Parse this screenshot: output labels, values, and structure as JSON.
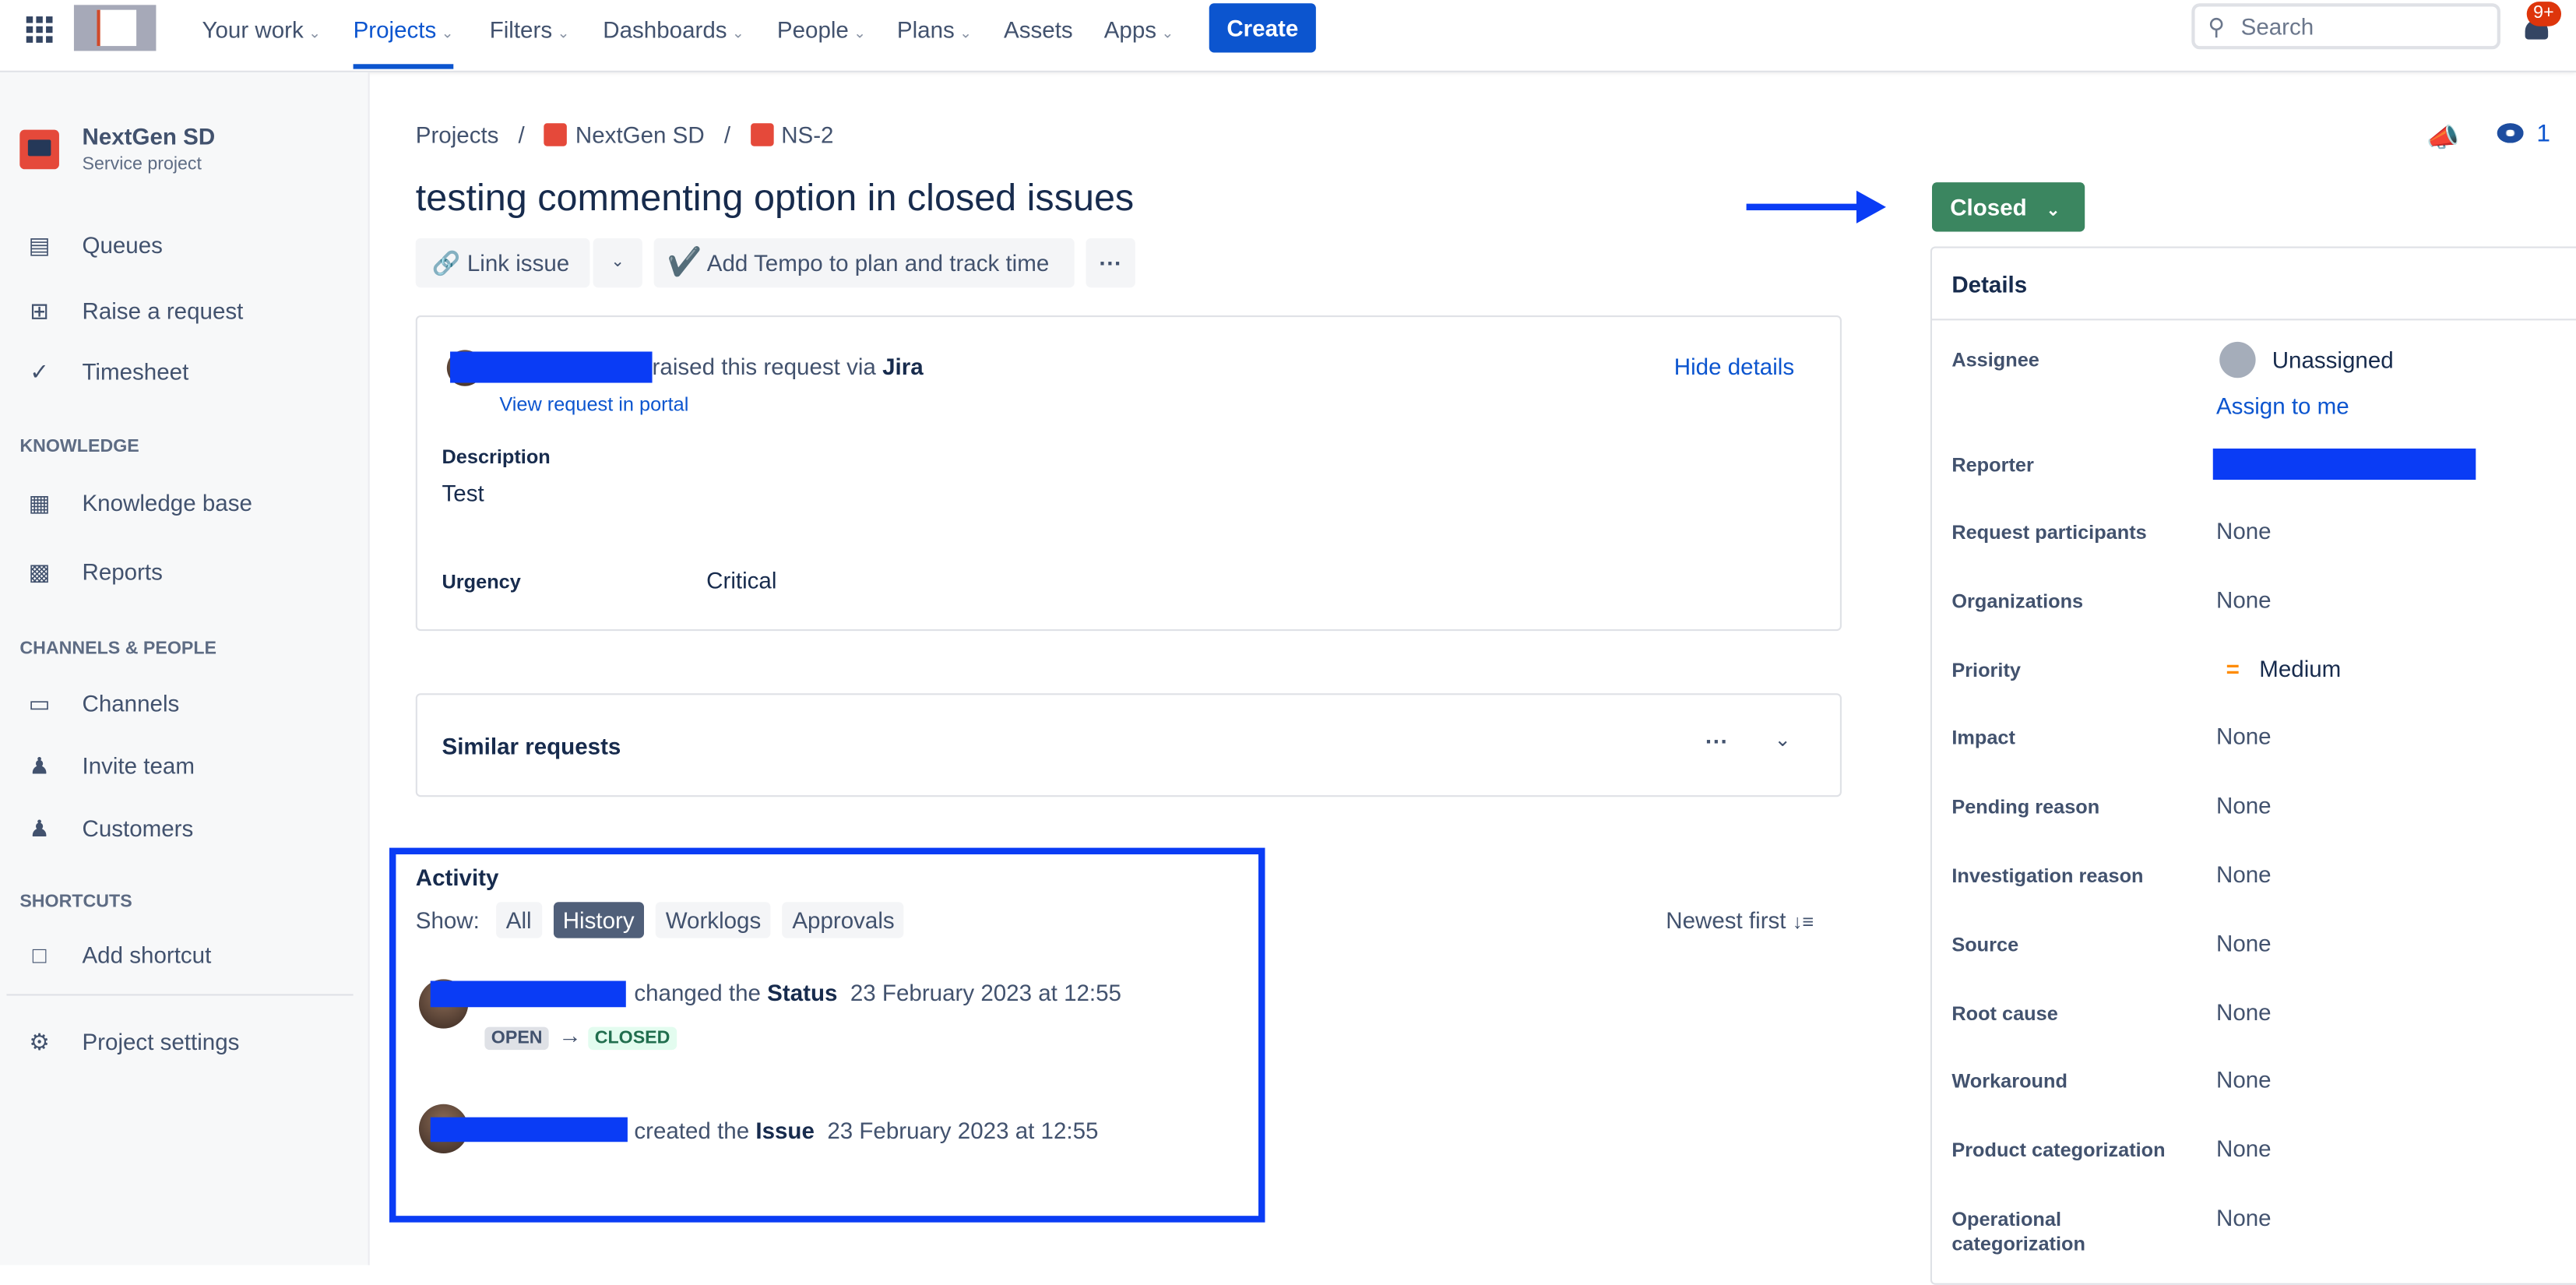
{
  "topnav": {
    "items": [
      {
        "label": "Your work",
        "dropdown": true
      },
      {
        "label": "Projects",
        "dropdown": true,
        "active": true
      },
      {
        "label": "Filters",
        "dropdown": true
      },
      {
        "label": "Dashboards",
        "dropdown": true
      },
      {
        "label": "People",
        "dropdown": true
      },
      {
        "label": "Plans",
        "dropdown": true
      },
      {
        "label": "Assets",
        "dropdown": false
      },
      {
        "label": "Apps",
        "dropdown": true
      }
    ],
    "create_label": "Create",
    "search_placeholder": "Search",
    "notification_badge": "9+",
    "accent": "#0c55cf"
  },
  "sidebar": {
    "project_name": "NextGen SD",
    "project_type": "Service project",
    "items": [
      {
        "label": "Queues",
        "icon": "queues-icon"
      },
      {
        "label": "Raise a request",
        "icon": "raise-request-icon"
      },
      {
        "label": "Timesheet",
        "icon": "check-circle-icon"
      }
    ],
    "knowledge_heading": "KNOWLEDGE",
    "knowledge": [
      {
        "label": "Knowledge base",
        "icon": "book-icon"
      },
      {
        "label": "Reports",
        "icon": "chart-icon"
      }
    ],
    "channels_heading": "CHANNELS & PEOPLE",
    "channels": [
      {
        "label": "Channels",
        "icon": "monitor-icon"
      },
      {
        "label": "Invite team",
        "icon": "person-add-icon"
      },
      {
        "label": "Customers",
        "icon": "people-icon"
      }
    ],
    "shortcuts_heading": "SHORTCUTS",
    "shortcuts": [
      {
        "label": "Add shortcut",
        "icon": "add-shortcut-icon"
      }
    ],
    "settings_label": "Project settings"
  },
  "breadcrumb": {
    "root": "Projects",
    "project": "NextGen SD",
    "issue": "NS-2"
  },
  "watchers_count": "1",
  "issue": {
    "title": "testing commenting option in closed issues",
    "link_issue": "Link issue",
    "tempo": "Add Tempo to plan and track time",
    "status": "Closed",
    "status_color": "#3b8660"
  },
  "request": {
    "raised_text": "raised this request via",
    "channel": "Jira",
    "view_portal": "View request in portal",
    "hide_details": "Hide details",
    "description_label": "Description",
    "description": "Test",
    "urgency_label": "Urgency",
    "urgency": "Critical"
  },
  "similar": {
    "title": "Similar requests"
  },
  "activity": {
    "title": "Activity",
    "show_label": "Show:",
    "filters": [
      "All",
      "History",
      "Worklogs",
      "Approvals"
    ],
    "active_filter": "History",
    "sort": "Newest first",
    "entries": [
      {
        "action": "changed the",
        "field": "Status",
        "time": "23 February 2023 at 12:55",
        "from": "OPEN",
        "to": "CLOSED"
      },
      {
        "action": "created the",
        "field": "Issue",
        "time": "23 February 2023 at 12:55"
      }
    ]
  },
  "details": {
    "title": "Details",
    "assignee_label": "Assignee",
    "assignee": "Unassigned",
    "assign_to_me": "Assign to me",
    "reporter_label": "Reporter",
    "fields": [
      {
        "label": "Request participants",
        "value": "None"
      },
      {
        "label": "Organizations",
        "value": "None"
      },
      {
        "label": "Priority",
        "value": "Medium"
      },
      {
        "label": "Impact",
        "value": "None"
      },
      {
        "label": "Pending reason",
        "value": "None"
      },
      {
        "label": "Investigation reason",
        "value": "None"
      },
      {
        "label": "Source",
        "value": "None"
      },
      {
        "label": "Root cause",
        "value": "None"
      },
      {
        "label": "Workaround",
        "value": "None"
      },
      {
        "label": "Product categorization",
        "value": "None"
      },
      {
        "label": "Operational categorization",
        "value": "None"
      }
    ]
  }
}
